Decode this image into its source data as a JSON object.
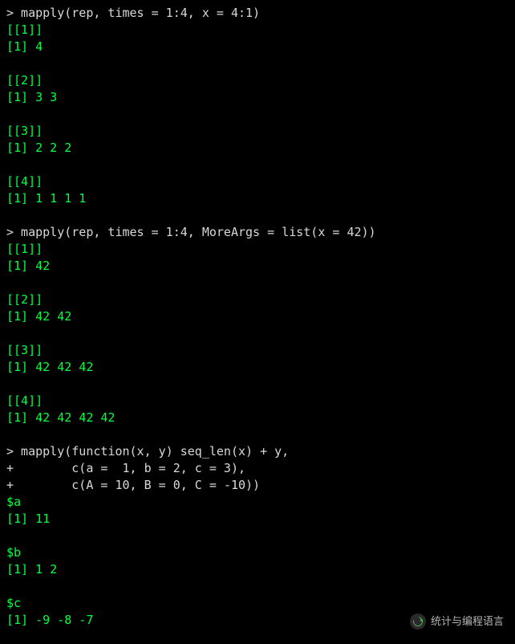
{
  "lines": [
    {
      "kind": "prompt",
      "text": "> mapply(rep, times = 1:4, x = 4:1)"
    },
    {
      "kind": "output",
      "text": "[[1]]"
    },
    {
      "kind": "output",
      "text": "[1] 4"
    },
    {
      "kind": "blank",
      "text": ""
    },
    {
      "kind": "output",
      "text": "[[2]]"
    },
    {
      "kind": "output",
      "text": "[1] 3 3"
    },
    {
      "kind": "blank",
      "text": ""
    },
    {
      "kind": "output",
      "text": "[[3]]"
    },
    {
      "kind": "output",
      "text": "[1] 2 2 2"
    },
    {
      "kind": "blank",
      "text": ""
    },
    {
      "kind": "output",
      "text": "[[4]]"
    },
    {
      "kind": "output",
      "text": "[1] 1 1 1 1"
    },
    {
      "kind": "blank",
      "text": ""
    },
    {
      "kind": "prompt",
      "text": "> mapply(rep, times = 1:4, MoreArgs = list(x = 42))"
    },
    {
      "kind": "output",
      "text": "[[1]]"
    },
    {
      "kind": "output",
      "text": "[1] 42"
    },
    {
      "kind": "blank",
      "text": ""
    },
    {
      "kind": "output",
      "text": "[[2]]"
    },
    {
      "kind": "output",
      "text": "[1] 42 42"
    },
    {
      "kind": "blank",
      "text": ""
    },
    {
      "kind": "output",
      "text": "[[3]]"
    },
    {
      "kind": "output",
      "text": "[1] 42 42 42"
    },
    {
      "kind": "blank",
      "text": ""
    },
    {
      "kind": "output",
      "text": "[[4]]"
    },
    {
      "kind": "output",
      "text": "[1] 42 42 42 42"
    },
    {
      "kind": "blank",
      "text": ""
    },
    {
      "kind": "prompt",
      "text": "> mapply(function(x, y) seq_len(x) + y,"
    },
    {
      "kind": "prompt",
      "text": "+        c(a =  1, b = 2, c = 3),"
    },
    {
      "kind": "prompt",
      "text": "+        c(A = 10, B = 0, C = -10))"
    },
    {
      "kind": "output",
      "text": "$a"
    },
    {
      "kind": "output",
      "text": "[1] 11"
    },
    {
      "kind": "blank",
      "text": ""
    },
    {
      "kind": "output",
      "text": "$b"
    },
    {
      "kind": "output",
      "text": "[1] 1 2"
    },
    {
      "kind": "blank",
      "text": ""
    },
    {
      "kind": "output",
      "text": "$c"
    },
    {
      "kind": "output",
      "text": "[1] -9 -8 -7"
    }
  ],
  "watermark": {
    "label": "统计与编程语言"
  }
}
